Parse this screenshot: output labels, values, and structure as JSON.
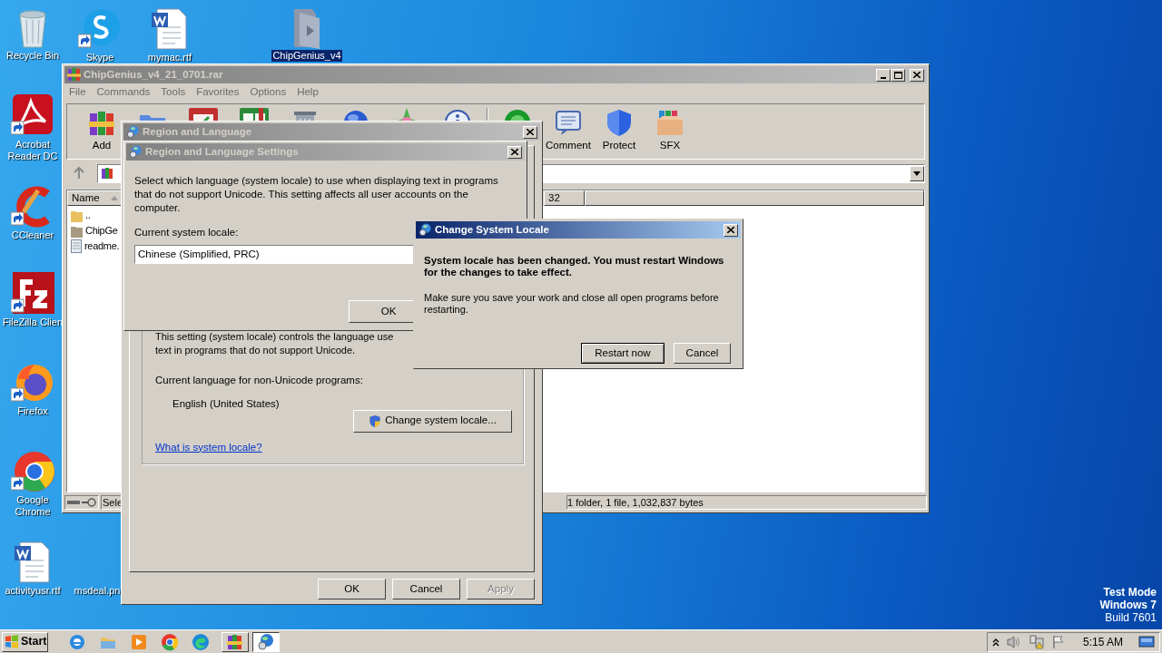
{
  "desktop_icons": [
    {
      "label": "Recycle Bin",
      "kind": "recycle",
      "shortcut": false,
      "selected": false
    },
    {
      "label": "Skype",
      "kind": "skype",
      "shortcut": true,
      "selected": false
    },
    {
      "label": "mymac.rtf",
      "kind": "word",
      "shortcut": false,
      "selected": false
    },
    {
      "label": "ChipGenius_v4",
      "kind": "folder",
      "shortcut": false,
      "selected": true
    },
    {
      "label": "Acrobat Reader DC",
      "kind": "acrobat",
      "shortcut": true,
      "selected": false
    },
    {
      "label": "CCleaner",
      "kind": "ccleaner",
      "shortcut": true,
      "selected": false
    },
    {
      "label": "FileZilla Clien",
      "kind": "filezilla",
      "shortcut": true,
      "selected": false
    },
    {
      "label": "Firefox",
      "kind": "firefox",
      "shortcut": true,
      "selected": false
    },
    {
      "label": "Google Chrome",
      "kind": "chrome",
      "shortcut": true,
      "selected": false
    },
    {
      "label": "activityusr.rtf",
      "kind": "word",
      "shortcut": false,
      "selected": false
    },
    {
      "label": "msdeal.pn",
      "kind": "hidden",
      "selected": false
    }
  ],
  "winrar": {
    "title": "ChipGenius_v4_21_0701.rar",
    "menu": [
      "File",
      "Commands",
      "Tools",
      "Favorites",
      "Options",
      "Help"
    ],
    "toolbar": [
      {
        "label": "Add",
        "kind": "archive"
      },
      {
        "kind": "folder"
      },
      {
        "kind": "clipboard"
      },
      {
        "kind": "book"
      },
      {
        "kind": "trash"
      },
      {
        "kind": "globe"
      },
      {
        "kind": "wand"
      },
      {
        "kind": "info"
      },
      {
        "kind": "virus"
      },
      {
        "label": "Comment",
        "kind": "comment"
      },
      {
        "label": "Protect",
        "kind": "shield"
      },
      {
        "label": "SFX",
        "kind": "box"
      }
    ],
    "columns": [
      "Name",
      "32"
    ],
    "files": [
      {
        "name": "..",
        "kind": "up"
      },
      {
        "name": "ChipGe",
        "kind": "folder"
      },
      {
        "name": "readme.",
        "kind": "text"
      }
    ],
    "status_left": "Sele",
    "status_right": "1 folder, 1 file, 1,032,837 bytes"
  },
  "region_language": {
    "title": "Region and Language",
    "group_text": "This setting (system locale) controls the language use\ntext in programs that do not support Unicode.",
    "current_label": "Current language for non-Unicode programs:",
    "current_value": "English (United States)",
    "change_button": "Change system locale...",
    "link": "What is system locale?",
    "buttons": [
      {
        "label": "OK",
        "disabled": false
      },
      {
        "label": "Cancel",
        "disabled": false
      },
      {
        "label": "Apply",
        "disabled": true
      }
    ]
  },
  "settings_dialog": {
    "title": "Region and Language Settings",
    "description": "Select which language (system locale) to use when displaying text in programs\nthat do not support Unicode. This setting affects all user accounts on the\ncomputer.",
    "locale_label": "Current system locale:",
    "locale_value": "Chinese (Simplified, PRC)",
    "buttons": [
      {
        "label": "OK"
      }
    ]
  },
  "change_locale_dialog": {
    "title": "Change System Locale",
    "message_bold": "System locale has been changed. You must restart Windows\nfor the changes to take effect.",
    "message": "Make sure you save your work and close all open programs before\nrestarting.",
    "buttons": [
      {
        "label": "Restart now",
        "default": true
      },
      {
        "label": "Cancel",
        "default": false
      }
    ]
  },
  "os_notice": [
    "Test Mode",
    "Windows 7",
    "Build 7601"
  ],
  "taskbar": {
    "start": "Start",
    "apps": [
      {
        "kind": "ie",
        "selected": false
      },
      {
        "kind": "explorer",
        "selected": false
      },
      {
        "kind": "media",
        "selected": false
      },
      {
        "kind": "chrome",
        "selected": false
      },
      {
        "kind": "edge",
        "selected": false
      },
      {
        "kind": "winrar",
        "selected": false
      },
      {
        "kind": "globe",
        "selected": true
      }
    ],
    "time": "5:15 AM"
  }
}
